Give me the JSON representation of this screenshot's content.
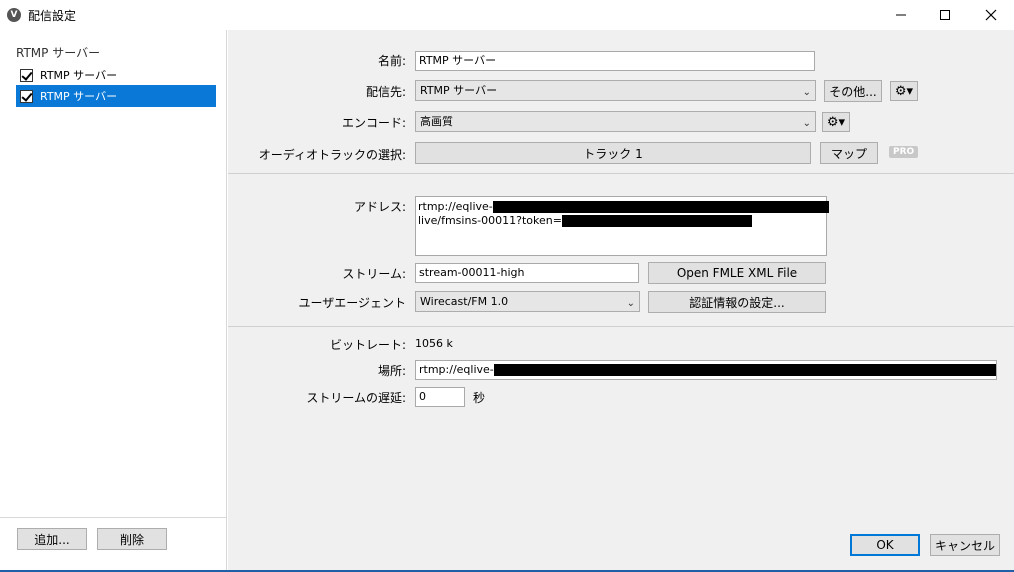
{
  "window": {
    "title": "配信設定",
    "app_icon": "V"
  },
  "sidebar": {
    "root_label": "RTMP サーバー",
    "items": [
      {
        "label": "RTMP サーバー",
        "checked": true,
        "selected": false
      },
      {
        "label": "RTMP サーバー",
        "checked": true,
        "selected": true
      }
    ],
    "add_label": "追加...",
    "delete_label": "削除"
  },
  "form": {
    "name_label": "名前:",
    "name_value": "RTMP サーバー",
    "destination_label": "配信先:",
    "destination_value": "RTMP サーバー",
    "other_label": "その他...",
    "encode_label": "エンコード:",
    "encode_value": "高画質",
    "audio_track_label": "オーディオトラックの選択:",
    "audio_track_value": "トラック 1",
    "map_label": "マップ",
    "pro_badge": "PRO",
    "address_label": "アドレス:",
    "address_line1": "rtmp://eqlive-",
    "address_line2": "live/fmsins-00011?token=",
    "stream_label": "ストリーム:",
    "stream_value": "stream-00011-high",
    "open_fmle_label": "Open FMLE XML File",
    "user_agent_label": "ユーザエージェント",
    "user_agent_value": "Wirecast/FM 1.0",
    "auth_label": "認証情報の設定...",
    "bitrate_label": "ビットレート:",
    "bitrate_value": "1056 k",
    "location_label": "場所:",
    "location_value": "rtmp://eqlive-",
    "delay_label": "ストリームの遅延:",
    "delay_value": "0",
    "delay_unit": "秒"
  },
  "footer": {
    "ok_label": "OK",
    "cancel_label": "キャンセル"
  },
  "colors": {
    "selection": "#0a78d7",
    "panel": "#f0f0f0",
    "redaction": "#000000"
  }
}
